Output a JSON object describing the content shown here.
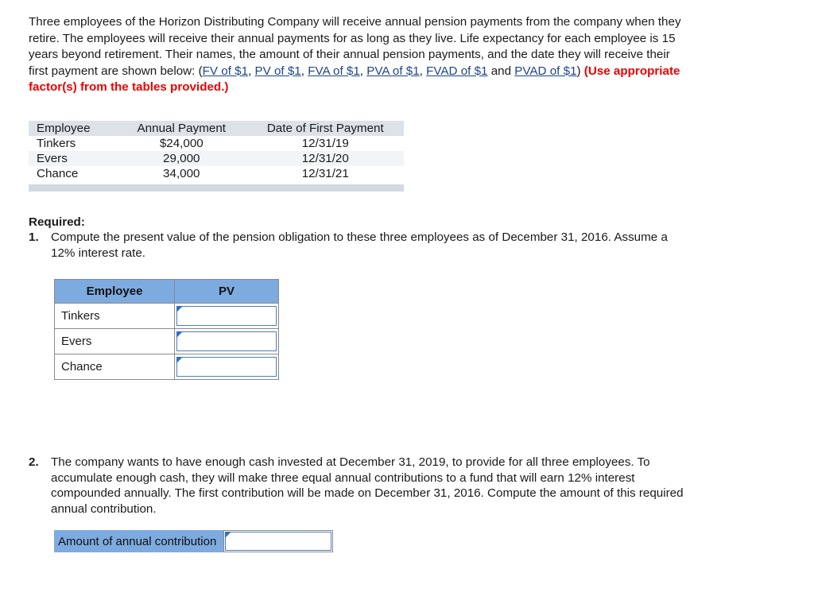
{
  "intro": {
    "part1": "Three employees of the Horizon Distributing Company will receive annual pension payments from the company when they retire. The employees will receive their annual payments for as long as they live. Life expectancy for each employee is 15 years beyond retirement. Their names, the amount of their annual pension payments, and the date they will receive their first payment are shown below: (",
    "link_fv": "FV of $1",
    "sep1": ", ",
    "link_pv": "PV of $1",
    "sep2": ", ",
    "link_fva": "FVA of $1",
    "sep3": ", ",
    "link_pva": "PVA of $1",
    "sep4": ", ",
    "link_fvad": "FVAD of $1",
    "sep5": " and ",
    "link_pvad": "PVAD of $1",
    "sep6": ") ",
    "note": "(Use appropriate factor(s) from the tables provided.)"
  },
  "data_table": {
    "headers": [
      "Employee",
      "Annual Payment",
      "Date of First Payment"
    ],
    "rows": [
      {
        "employee": "Tinkers",
        "annual_payment": "$24,000",
        "date_of_first_payment": "12/31/19"
      },
      {
        "employee": "Evers",
        "annual_payment": "29,000",
        "date_of_first_payment": "12/31/20"
      },
      {
        "employee": "Chance",
        "annual_payment": "34,000",
        "date_of_first_payment": "12/31/21"
      }
    ]
  },
  "required": {
    "heading": "Required:",
    "q1": {
      "number": "1.",
      "text": "Compute the present value of the pension obligation to these three employees as of December 31, 2016. Assume a 12% interest rate."
    },
    "q2": {
      "number": "2.",
      "text": "The company wants to have enough cash invested at December 31, 2019, to provide for all three employees. To accumulate enough cash, they will make three equal annual contributions to a fund that will earn 12% interest compounded annually. The first contribution will be made on December 31, 2016. Compute the amount of this required annual contribution."
    }
  },
  "pv_table": {
    "headers": [
      "Employee",
      "PV"
    ],
    "rows": [
      {
        "employee": "Tinkers",
        "pv_value": "",
        "pv_placeholder": ""
      },
      {
        "employee": "Evers",
        "pv_value": "",
        "pv_placeholder": ""
      },
      {
        "employee": "Chance",
        "pv_value": "",
        "pv_placeholder": ""
      }
    ]
  },
  "contribution": {
    "label": "Amount of annual contribution",
    "value": "",
    "placeholder": ""
  },
  "colors": {
    "header_blue": "#7dabdf",
    "table_header_gray": "#dde1e8",
    "table_footer_gray": "#d3d9e3",
    "link_blue": "#1c4587",
    "note_red": "#ee0000",
    "input_border_blue": "#4a7fc1"
  }
}
